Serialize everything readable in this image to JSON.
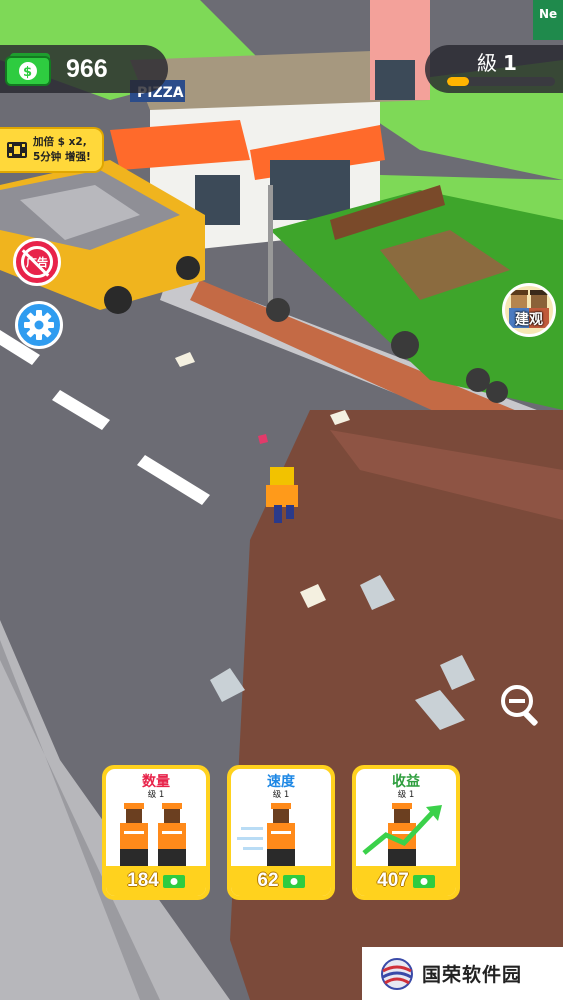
{
  "hud": {
    "money_value": "966",
    "level_label": "級",
    "level_value": "1",
    "level_progress": 0.2
  },
  "boost": {
    "line1": "加倍 $ x2,",
    "line2": "5分钟 增强!"
  },
  "buttons": {
    "no_ads_label": "广告",
    "spectate_label": "建观"
  },
  "scene_signs": {
    "pizza": "PIZZA",
    "corner": "Ne"
  },
  "upgrades": [
    {
      "title": "数量",
      "level": "级 1",
      "price": "184",
      "title_color": "#e8234a"
    },
    {
      "title": "速度",
      "level": "级 1",
      "price": "62",
      "title_color": "#1e88e5"
    },
    {
      "title": "收益",
      "level": "级 1",
      "price": "407",
      "title_color": "#2e9e3e"
    }
  ],
  "watermark": {
    "text": "国荣软件园"
  },
  "icons": [
    "cash-icon",
    "film-icon",
    "no-ads-icon",
    "gear-icon",
    "spectate-avatar-icon",
    "zoom-out-icon",
    "workers-icon",
    "speed-worker-icon",
    "income-worker-icon",
    "logo-globe-icon"
  ],
  "colors": {
    "accent": "#ffd21e",
    "level_fill": "#ffb400",
    "money_green": "#2ecc40"
  }
}
